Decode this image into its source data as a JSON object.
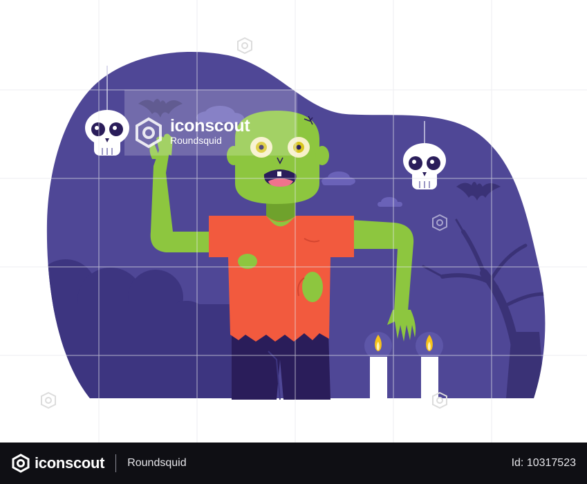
{
  "illustration": {
    "subject": "zombie",
    "colors": {
      "background_blob": "#4f4796",
      "bush": "#3d3580",
      "tree": "#3a3276",
      "cloud": "#6a62b8",
      "zombie_skin": "#8dc63f",
      "zombie_skin_shadow": "#6fa22c",
      "shirt": "#f25a3e",
      "pants": "#2a1d5a",
      "candle": "#ffffff",
      "flame": "#f7c21a",
      "skull": "#ffffff",
      "eye": "#2a1d5a"
    }
  },
  "watermark": {
    "brand": "iconscout",
    "author": "Roundsquid"
  },
  "footer": {
    "brand": "iconscout",
    "author": "Roundsquid",
    "asset_id": "Id: 10317523"
  }
}
